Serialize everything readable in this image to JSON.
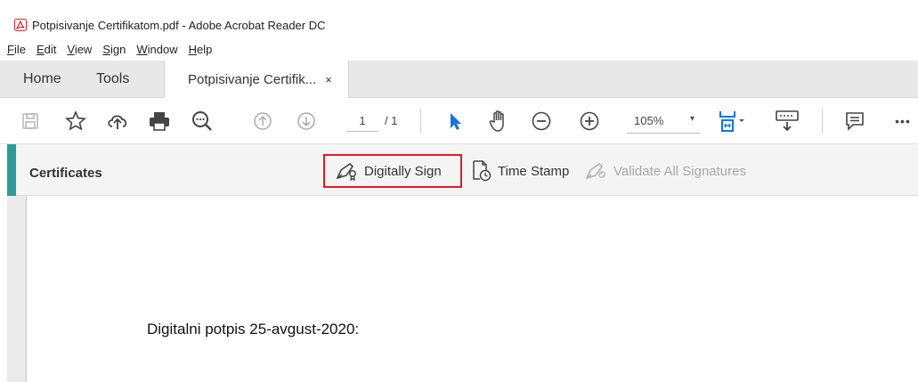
{
  "window": {
    "title": "Potpisivanje Certifikatom.pdf - Adobe Acrobat Reader DC"
  },
  "menu": [
    {
      "label_ul": "F",
      "label_rest": "ile"
    },
    {
      "label_ul": "E",
      "label_rest": "dit"
    },
    {
      "label_ul": "V",
      "label_rest": "iew"
    },
    {
      "label_ul": "S",
      "label_rest": "ign"
    },
    {
      "label_ul": "W",
      "label_rest": "indow"
    },
    {
      "label_ul": "H",
      "label_rest": "elp"
    }
  ],
  "tabs": {
    "home": "Home",
    "tools": "Tools",
    "doc": "Potpisivanje Certifik...",
    "close": "×"
  },
  "toolbar": {
    "page_current": "1",
    "page_total": "/ 1",
    "zoom": "105%",
    "zoom_caret": "▾",
    "more": "•••",
    "icons": [
      "save-icon",
      "bookmark-star-icon",
      "upload-cloud-icon",
      "print-icon",
      "find-zoom-icon",
      "previous-page-icon",
      "next-page-icon",
      "select-arrow-icon",
      "hand-tool-icon",
      "zoom-out-icon",
      "zoom-in-icon",
      "page-fit-icon",
      "keyboard-icon",
      "comment-icon",
      "more-icon"
    ]
  },
  "certificates": {
    "title": "Certificates",
    "digitally_sign": "Digitally Sign",
    "time_stamp": "Time Stamp",
    "validate_all": "Validate All Signatures"
  },
  "document": {
    "text": "Digitalni potpis 25-avgust-2020:"
  },
  "colors": {
    "accent_teal": "#2a9d9b",
    "highlight_red": "#e21b22",
    "acrobat_red": "#d0242b",
    "select_blue": "#1473e6"
  }
}
